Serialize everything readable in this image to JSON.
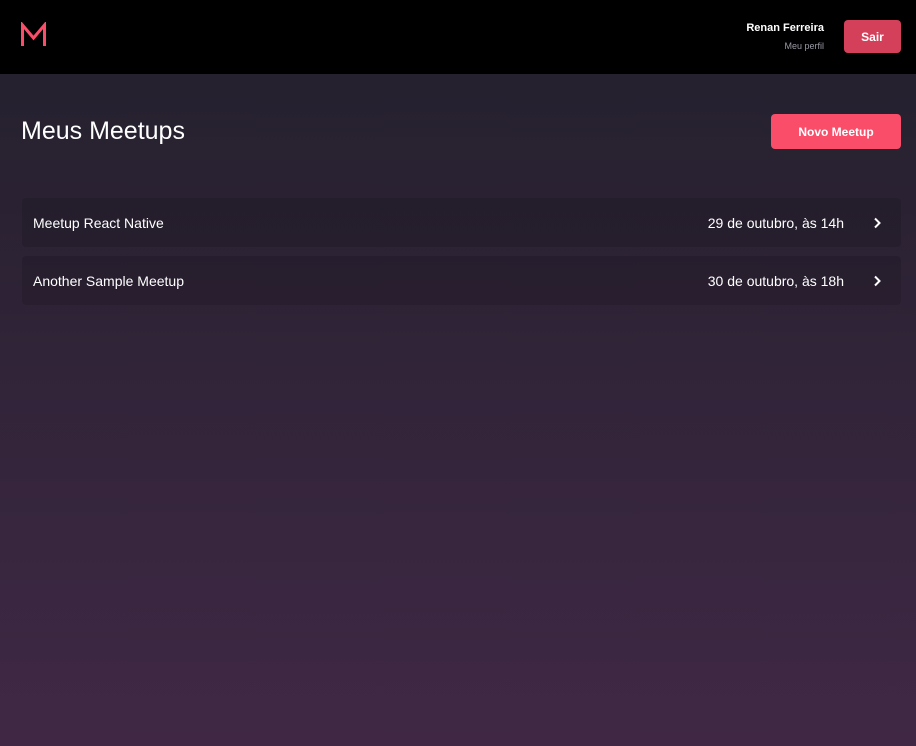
{
  "header": {
    "logo_icon": "meetapp-m-logo-icon",
    "user": {
      "name": "Renan Ferreira",
      "profile_link": "Meu perfil"
    },
    "logout_label": "Sair"
  },
  "main": {
    "title": "Meus Meetups",
    "new_button_label": "Novo Meetup",
    "meetups": [
      {
        "title": "Meetup React Native",
        "date": "29 de outubro, às 14h",
        "icon": "chevron-right-icon"
      },
      {
        "title": "Another Sample Meetup",
        "date": "30 de outubro, às 18h",
        "icon": "chevron-right-icon"
      }
    ]
  },
  "colors": {
    "header_bg": "#000000",
    "accent": "#f94d6a",
    "logout_bg": "#d44059",
    "gradient_top": "#22202c",
    "gradient_bottom": "#402845"
  }
}
